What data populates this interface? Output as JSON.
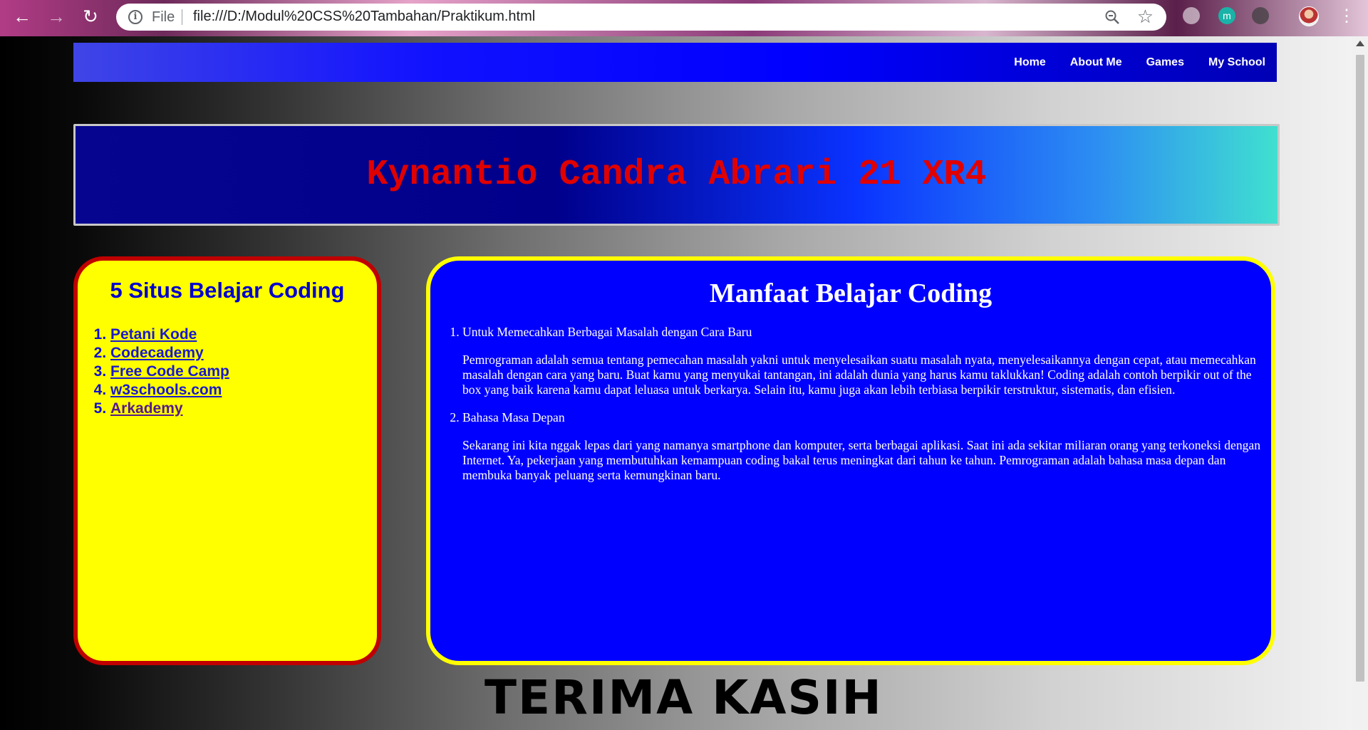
{
  "browser": {
    "file_label": "File",
    "url": "file:///D:/Modul%20CSS%20Tambahan/Praktikum.html",
    "ext_m_label": "m"
  },
  "nav": {
    "items": [
      "Home",
      "About Me",
      "Games",
      "My School"
    ]
  },
  "header": {
    "title": "Kynantio Candra Abrari 21 XR4"
  },
  "sidebar": {
    "title": "5 Situs Belajar Coding",
    "links": [
      "Petani Kode",
      "Codecademy",
      "Free Code Camp",
      "w3schools.com",
      "Arkademy"
    ]
  },
  "main": {
    "title": "Manfaat Belajar Coding",
    "items": [
      {
        "title": "Untuk Memecahkan Berbagai Masalah dengan Cara Baru",
        "body": "Pemrograman adalah semua tentang pemecahan masalah yakni untuk menyelesaikan suatu masalah nyata, menyelesaikannya dengan cepat, atau memecahkan masalah dengan cara yang baru. Buat kamu yang menyukai tantangan, ini adalah dunia yang harus kamu taklukkan! Coding adalah contoh berpikir out of the box yang baik karena kamu dapat leluasa untuk berkarya. Selain itu, kamu juga akan lebih terbiasa berpikir terstruktur, sistematis, dan efisien."
      },
      {
        "title": "Bahasa Masa Depan",
        "body": "Sekarang ini kita nggak lepas dari yang namanya smartphone dan komputer, serta berbagai aplikasi. Saat ini ada sekitar miliaran orang yang terkoneksi dengan Internet. Ya, pekerjaan yang membutuhkan kemampuan coding bakal terus meningkat dari tahun ke tahun. Pemrograman adalah bahasa masa depan dan membuka banyak peluang serta kemungkinan baru."
      }
    ]
  },
  "footer": {
    "text": "TERIMA KASIH"
  }
}
